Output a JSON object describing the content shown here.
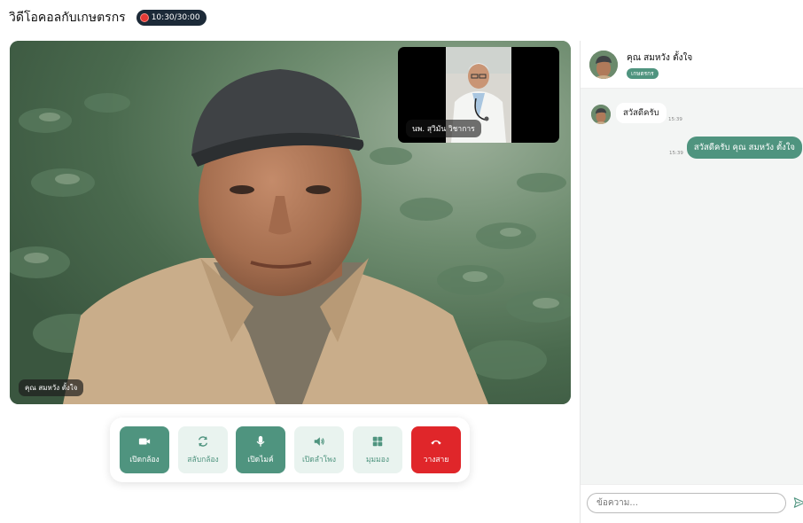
{
  "header": {
    "title": "วิดีโอคอลกับเกษตรกร",
    "timer": "10:30/30:00"
  },
  "video": {
    "main_name": "คุณ สมหวัง ตั้งใจ",
    "pip_name": "นพ. สุวิมัน วิชาการ"
  },
  "controls": [
    {
      "label": "เปิดกล้อง",
      "icon": "camera-icon",
      "state": "on"
    },
    {
      "label": "สลับกล้อง",
      "icon": "switch-camera-icon",
      "state": "off"
    },
    {
      "label": "เปิดไมค์",
      "icon": "microphone-icon",
      "state": "on"
    },
    {
      "label": "เปิดลำโพง",
      "icon": "speaker-icon",
      "state": "off"
    },
    {
      "label": "มุมมอง",
      "icon": "grid-view-icon",
      "state": "off"
    },
    {
      "label": "วางสาย",
      "icon": "hang-up-icon",
      "state": "end"
    }
  ],
  "chat": {
    "contact_name": "คุณ สมหวัง ตั้งใจ",
    "contact_role": "เกษตรกร",
    "messages": [
      {
        "from": "contact",
        "text": "สวัสดีครับ",
        "time": "15:39"
      },
      {
        "from": "me",
        "text": "สวัสดีครับ คุณ สมหวัง ตั้งใจ",
        "time": "15:39"
      }
    ],
    "input_placeholder": "ข้อความ..."
  },
  "colors": {
    "accent": "#4f947f",
    "accent_light": "#e9f3ef",
    "danger": "#e0262a",
    "timer_bg": "#1c2a38",
    "recording": "#e53935"
  }
}
